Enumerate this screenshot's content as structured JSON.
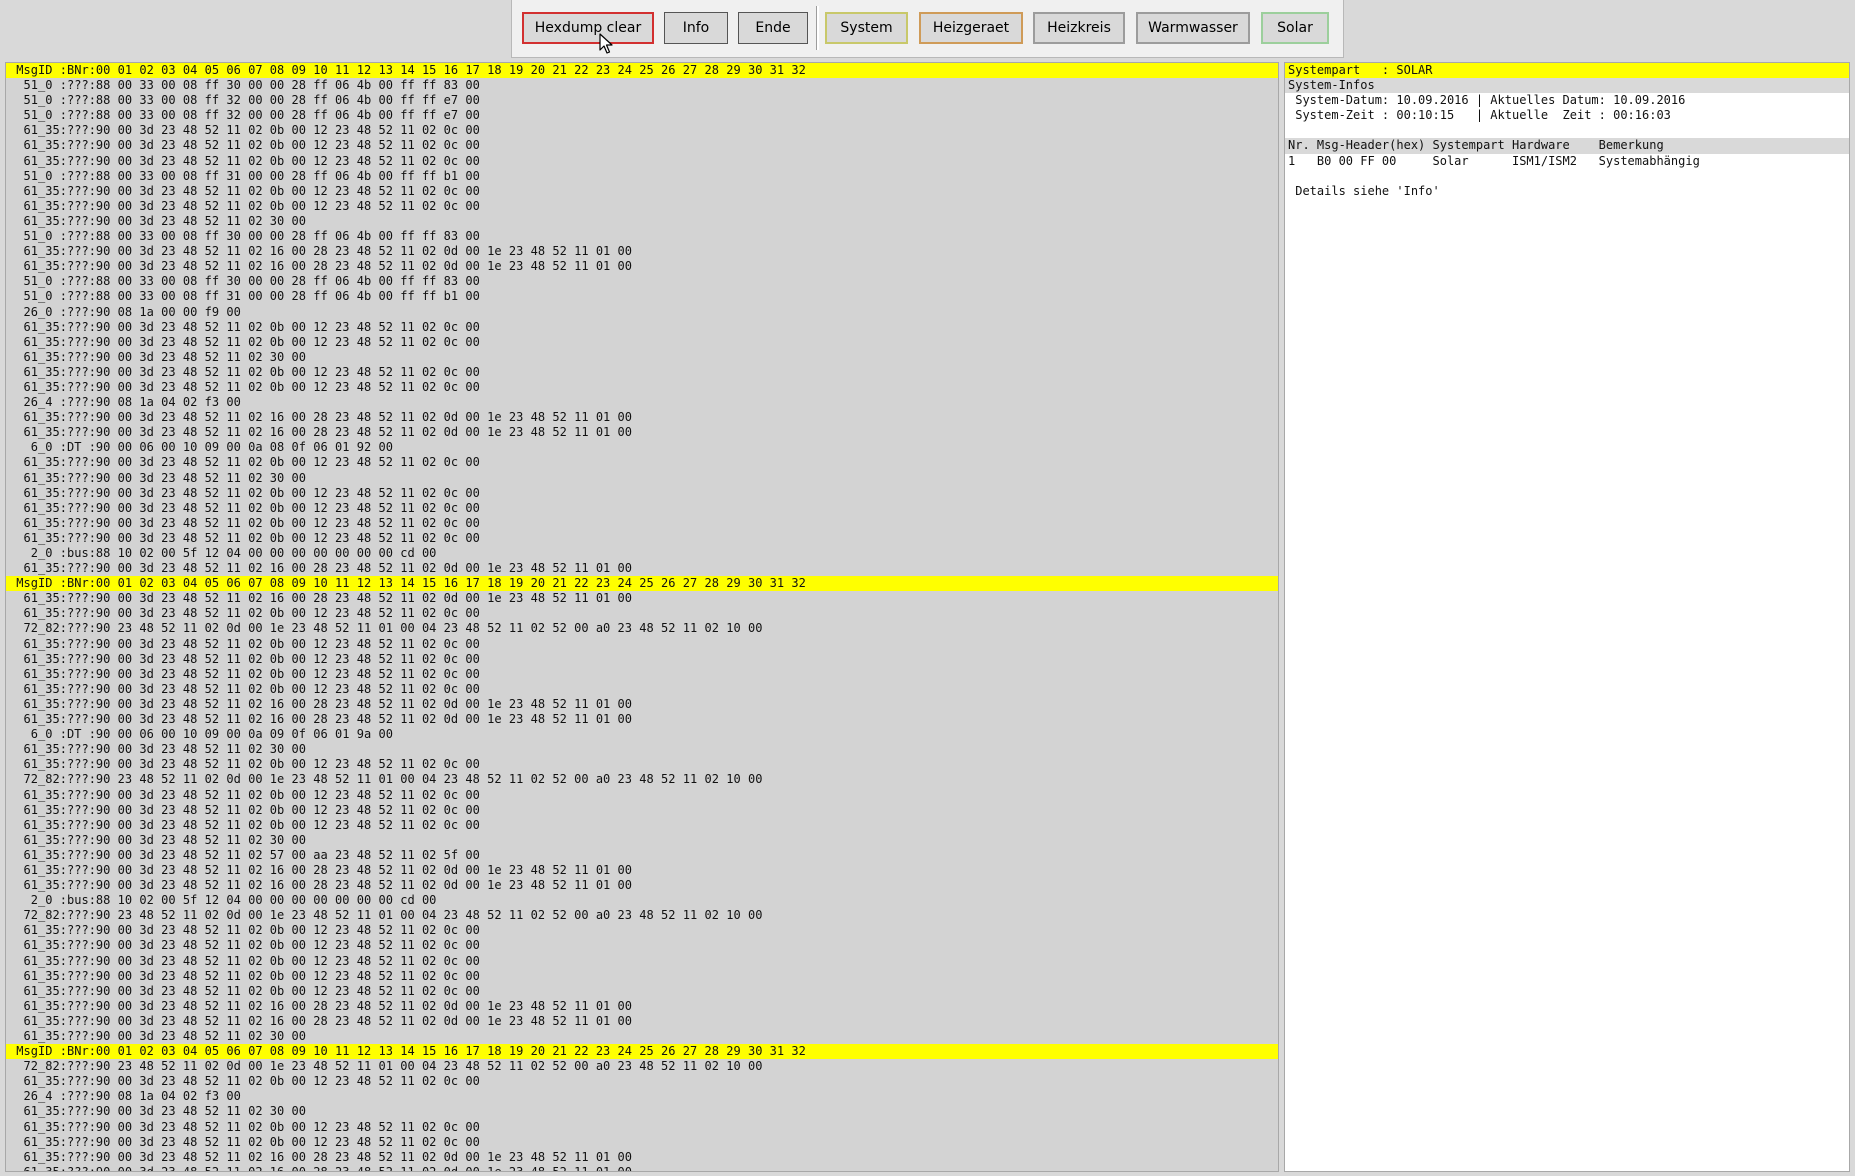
{
  "toolbar": {
    "hexdump_clear": "Hexdump clear",
    "info": "Info",
    "ende": "Ende",
    "system": "System",
    "heizgeraet": "Heizgeraet",
    "heizkreis": "Heizkreis",
    "warmwasser": "Warmwasser",
    "solar": "Solar"
  },
  "hexdump": {
    "lines": [
      {
        "text": " MsgID :BNr:00 01 02 03 04 05 06 07 08 09 10 11 12 13 14 15 16 17 18 19 20 21 22 23 24 25 26 27 28 29 30 31 32",
        "header": true
      },
      {
        "text": "  51_0 :???:88 00 33 00 08 ff 30 00 00 28 ff 06 4b 00 ff ff 83 00"
      },
      {
        "text": "  51_0 :???:88 00 33 00 08 ff 32 00 00 28 ff 06 4b 00 ff ff e7 00"
      },
      {
        "text": "  51_0 :???:88 00 33 00 08 ff 32 00 00 28 ff 06 4b 00 ff ff e7 00"
      },
      {
        "text": "  61_35:???:90 00 3d 23 48 52 11 02 0b 00 12 23 48 52 11 02 0c 00"
      },
      {
        "text": "  61_35:???:90 00 3d 23 48 52 11 02 0b 00 12 23 48 52 11 02 0c 00"
      },
      {
        "text": "  61_35:???:90 00 3d 23 48 52 11 02 0b 00 12 23 48 52 11 02 0c 00"
      },
      {
        "text": "  51_0 :???:88 00 33 00 08 ff 31 00 00 28 ff 06 4b 00 ff ff b1 00"
      },
      {
        "text": "  61_35:???:90 00 3d 23 48 52 11 02 0b 00 12 23 48 52 11 02 0c 00"
      },
      {
        "text": "  61_35:???:90 00 3d 23 48 52 11 02 0b 00 12 23 48 52 11 02 0c 00"
      },
      {
        "text": "  61_35:???:90 00 3d 23 48 52 11 02 30 00"
      },
      {
        "text": "  51_0 :???:88 00 33 00 08 ff 30 00 00 28 ff 06 4b 00 ff ff 83 00"
      },
      {
        "text": "  61_35:???:90 00 3d 23 48 52 11 02 16 00 28 23 48 52 11 02 0d 00 1e 23 48 52 11 01 00"
      },
      {
        "text": "  61_35:???:90 00 3d 23 48 52 11 02 16 00 28 23 48 52 11 02 0d 00 1e 23 48 52 11 01 00"
      },
      {
        "text": "  51_0 :???:88 00 33 00 08 ff 30 00 00 28 ff 06 4b 00 ff ff 83 00"
      },
      {
        "text": "  51_0 :???:88 00 33 00 08 ff 31 00 00 28 ff 06 4b 00 ff ff b1 00"
      },
      {
        "text": "  26_0 :???:90 08 1a 00 00 f9 00"
      },
      {
        "text": "  61_35:???:90 00 3d 23 48 52 11 02 0b 00 12 23 48 52 11 02 0c 00"
      },
      {
        "text": "  61_35:???:90 00 3d 23 48 52 11 02 0b 00 12 23 48 52 11 02 0c 00"
      },
      {
        "text": "  61_35:???:90 00 3d 23 48 52 11 02 30 00"
      },
      {
        "text": "  61_35:???:90 00 3d 23 48 52 11 02 0b 00 12 23 48 52 11 02 0c 00"
      },
      {
        "text": "  61_35:???:90 00 3d 23 48 52 11 02 0b 00 12 23 48 52 11 02 0c 00"
      },
      {
        "text": "  26_4 :???:90 08 1a 04 02 f3 00"
      },
      {
        "text": "  61_35:???:90 00 3d 23 48 52 11 02 16 00 28 23 48 52 11 02 0d 00 1e 23 48 52 11 01 00"
      },
      {
        "text": "  61_35:???:90 00 3d 23 48 52 11 02 16 00 28 23 48 52 11 02 0d 00 1e 23 48 52 11 01 00"
      },
      {
        "text": "   6_0 :DT :90 00 06 00 10 09 00 0a 08 0f 06 01 92 00"
      },
      {
        "text": "  61_35:???:90 00 3d 23 48 52 11 02 0b 00 12 23 48 52 11 02 0c 00"
      },
      {
        "text": "  61_35:???:90 00 3d 23 48 52 11 02 30 00"
      },
      {
        "text": "  61_35:???:90 00 3d 23 48 52 11 02 0b 00 12 23 48 52 11 02 0c 00"
      },
      {
        "text": "  61_35:???:90 00 3d 23 48 52 11 02 0b 00 12 23 48 52 11 02 0c 00"
      },
      {
        "text": "  61_35:???:90 00 3d 23 48 52 11 02 0b 00 12 23 48 52 11 02 0c 00"
      },
      {
        "text": "  61_35:???:90 00 3d 23 48 52 11 02 0b 00 12 23 48 52 11 02 0c 00"
      },
      {
        "text": "   2_0 :bus:88 10 02 00 5f 12 04 00 00 00 00 00 00 00 cd 00"
      },
      {
        "text": "  61_35:???:90 00 3d 23 48 52 11 02 16 00 28 23 48 52 11 02 0d 00 1e 23 48 52 11 01 00"
      },
      {
        "text": " MsgID :BNr:00 01 02 03 04 05 06 07 08 09 10 11 12 13 14 15 16 17 18 19 20 21 22 23 24 25 26 27 28 29 30 31 32",
        "header": true
      },
      {
        "text": "  61_35:???:90 00 3d 23 48 52 11 02 16 00 28 23 48 52 11 02 0d 00 1e 23 48 52 11 01 00"
      },
      {
        "text": "  61_35:???:90 00 3d 23 48 52 11 02 0b 00 12 23 48 52 11 02 0c 00"
      },
      {
        "text": "  72_82:???:90 23 48 52 11 02 0d 00 1e 23 48 52 11 01 00 04 23 48 52 11 02 52 00 a0 23 48 52 11 02 10 00"
      },
      {
        "text": "  61_35:???:90 00 3d 23 48 52 11 02 0b 00 12 23 48 52 11 02 0c 00"
      },
      {
        "text": "  61_35:???:90 00 3d 23 48 52 11 02 0b 00 12 23 48 52 11 02 0c 00"
      },
      {
        "text": "  61_35:???:90 00 3d 23 48 52 11 02 0b 00 12 23 48 52 11 02 0c 00"
      },
      {
        "text": "  61_35:???:90 00 3d 23 48 52 11 02 0b 00 12 23 48 52 11 02 0c 00"
      },
      {
        "text": "  61_35:???:90 00 3d 23 48 52 11 02 16 00 28 23 48 52 11 02 0d 00 1e 23 48 52 11 01 00"
      },
      {
        "text": "  61_35:???:90 00 3d 23 48 52 11 02 16 00 28 23 48 52 11 02 0d 00 1e 23 48 52 11 01 00"
      },
      {
        "text": "   6_0 :DT :90 00 06 00 10 09 00 0a 09 0f 06 01 9a 00"
      },
      {
        "text": "  61_35:???:90 00 3d 23 48 52 11 02 30 00"
      },
      {
        "text": "  61_35:???:90 00 3d 23 48 52 11 02 0b 00 12 23 48 52 11 02 0c 00"
      },
      {
        "text": "  72_82:???:90 23 48 52 11 02 0d 00 1e 23 48 52 11 01 00 04 23 48 52 11 02 52 00 a0 23 48 52 11 02 10 00"
      },
      {
        "text": "  61_35:???:90 00 3d 23 48 52 11 02 0b 00 12 23 48 52 11 02 0c 00"
      },
      {
        "text": "  61_35:???:90 00 3d 23 48 52 11 02 0b 00 12 23 48 52 11 02 0c 00"
      },
      {
        "text": "  61_35:???:90 00 3d 23 48 52 11 02 0b 00 12 23 48 52 11 02 0c 00"
      },
      {
        "text": "  61_35:???:90 00 3d 23 48 52 11 02 30 00"
      },
      {
        "text": "  61_35:???:90 00 3d 23 48 52 11 02 57 00 aa 23 48 52 11 02 5f 00"
      },
      {
        "text": "  61_35:???:90 00 3d 23 48 52 11 02 16 00 28 23 48 52 11 02 0d 00 1e 23 48 52 11 01 00"
      },
      {
        "text": "  61_35:???:90 00 3d 23 48 52 11 02 16 00 28 23 48 52 11 02 0d 00 1e 23 48 52 11 01 00"
      },
      {
        "text": "   2_0 :bus:88 10 02 00 5f 12 04 00 00 00 00 00 00 00 cd 00"
      },
      {
        "text": "  72_82:???:90 23 48 52 11 02 0d 00 1e 23 48 52 11 01 00 04 23 48 52 11 02 52 00 a0 23 48 52 11 02 10 00"
      },
      {
        "text": "  61_35:???:90 00 3d 23 48 52 11 02 0b 00 12 23 48 52 11 02 0c 00"
      },
      {
        "text": "  61_35:???:90 00 3d 23 48 52 11 02 0b 00 12 23 48 52 11 02 0c 00"
      },
      {
        "text": "  61_35:???:90 00 3d 23 48 52 11 02 0b 00 12 23 48 52 11 02 0c 00"
      },
      {
        "text": "  61_35:???:90 00 3d 23 48 52 11 02 0b 00 12 23 48 52 11 02 0c 00"
      },
      {
        "text": "  61_35:???:90 00 3d 23 48 52 11 02 0b 00 12 23 48 52 11 02 0c 00"
      },
      {
        "text": "  61_35:???:90 00 3d 23 48 52 11 02 16 00 28 23 48 52 11 02 0d 00 1e 23 48 52 11 01 00"
      },
      {
        "text": "  61_35:???:90 00 3d 23 48 52 11 02 16 00 28 23 48 52 11 02 0d 00 1e 23 48 52 11 01 00"
      },
      {
        "text": "  61_35:???:90 00 3d 23 48 52 11 02 30 00"
      },
      {
        "text": " MsgID :BNr:00 01 02 03 04 05 06 07 08 09 10 11 12 13 14 15 16 17 18 19 20 21 22 23 24 25 26 27 28 29 30 31 32",
        "header": true
      },
      {
        "text": "  72_82:???:90 23 48 52 11 02 0d 00 1e 23 48 52 11 01 00 04 23 48 52 11 02 52 00 a0 23 48 52 11 02 10 00"
      },
      {
        "text": "  61_35:???:90 00 3d 23 48 52 11 02 0b 00 12 23 48 52 11 02 0c 00"
      },
      {
        "text": "  26_4 :???:90 08 1a 04 02 f3 00"
      },
      {
        "text": "  61_35:???:90 00 3d 23 48 52 11 02 30 00"
      },
      {
        "text": "  61_35:???:90 00 3d 23 48 52 11 02 0b 00 12 23 48 52 11 02 0c 00"
      },
      {
        "text": "  61_35:???:90 00 3d 23 48 52 11 02 0b 00 12 23 48 52 11 02 0c 00"
      },
      {
        "text": "  61_35:???:90 00 3d 23 48 52 11 02 16 00 28 23 48 52 11 02 0d 00 1e 23 48 52 11 01 00"
      },
      {
        "text": "  61_35:???:90 00 3d 23 48 52 11 02 16 00 28 23 48 52 11 02 0d 00 1e 23 48 52 11 01 00"
      }
    ]
  },
  "info": {
    "lines": [
      {
        "text": "Systempart   : SOLAR",
        "style": "yellow"
      },
      {
        "text": "System-Infos",
        "style": "grey"
      },
      {
        "text": " System-Datum: 10.09.2016 | Aktuelles Datum: 10.09.2016"
      },
      {
        "text": " System-Zeit : 00:10:15   | Aktuelle  Zeit : 00:16:03"
      },
      {
        "text": ""
      },
      {
        "text": "Nr. Msg-Header(hex) Systempart Hardware    Bemerkung",
        "style": "grey"
      },
      {
        "text": "1   B0 00 FF 00     Solar      ISM1/ISM2   Systemabhängig"
      },
      {
        "text": ""
      },
      {
        "text": " Details siehe 'Info'"
      }
    ]
  },
  "colors": {
    "header_highlight": "#ffff00",
    "panel_bg": "#d3d3d3",
    "info_bg": "#ffffff"
  }
}
